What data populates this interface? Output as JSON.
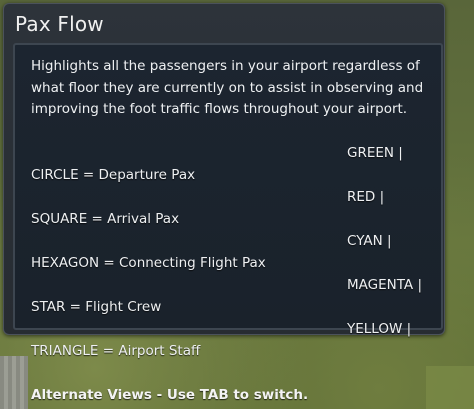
{
  "panel": {
    "title": "Pax Flow",
    "description": "Highlights all the passengers in your airport regardless of what floor they are currently on to assist in observing and improving the foot traffic flows throughout your airport."
  },
  "legend": [
    {
      "shape": "CIRCLE = Departure Pax",
      "color": "GREEN |"
    },
    {
      "shape": "SQUARE = Arrival Pax",
      "color": "RED |"
    },
    {
      "shape": "HEXAGON = Connecting Flight Pax",
      "color": "CYAN |"
    },
    {
      "shape": "STAR = Flight Crew",
      "color": "MAGENTA |"
    },
    {
      "shape": "TRIANGLE = Airport Staff",
      "color": "YELLOW |"
    }
  ],
  "footer": {
    "hint": "Alternate Views - Use TAB to switch."
  }
}
